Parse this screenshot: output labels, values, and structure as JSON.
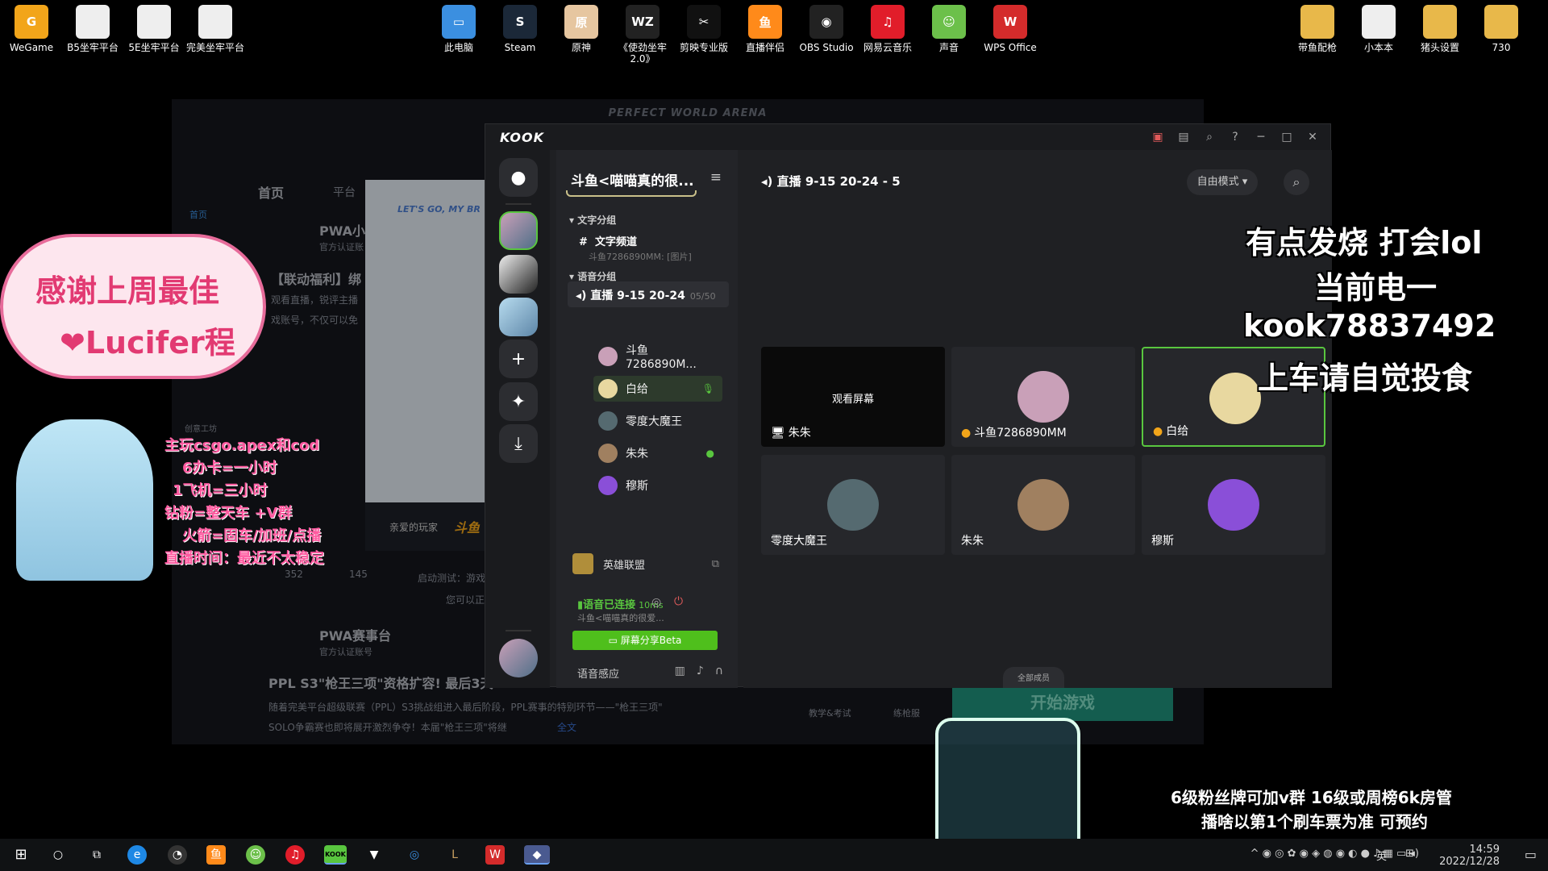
{
  "desktop": {
    "left_icons": [
      {
        "label": "WeGame",
        "glyph": "G",
        "color": "#f2a51a"
      },
      {
        "label": "B5坐牢平台",
        "glyph": "",
        "color": "doc"
      },
      {
        "label": "5E坐牢平台",
        "glyph": "",
        "color": "doc"
      },
      {
        "label": "完美坐牢平台",
        "glyph": "",
        "color": "doc"
      }
    ],
    "center_icons": [
      {
        "label": "此电脑",
        "glyph": "▭",
        "color": "#3b8fe0"
      },
      {
        "label": "Steam",
        "glyph": "S",
        "color": "#1b2838"
      },
      {
        "label": "原神",
        "glyph": "原",
        "color": "#e6c6a0"
      },
      {
        "label": "《使劲坐牢 2.0》",
        "glyph": "WZ",
        "color": "#222"
      },
      {
        "label": "剪映专业版",
        "glyph": "✂",
        "color": "#111"
      },
      {
        "label": "直播伴侣",
        "glyph": "鱼",
        "color": "#ff8a1a"
      },
      {
        "label": "OBS Studio",
        "glyph": "◉",
        "color": "#222"
      },
      {
        "label": "网易云音乐",
        "glyph": "♫",
        "color": "#e11d2a"
      },
      {
        "label": "声音",
        "glyph": "☺",
        "color": "#6cc04a"
      },
      {
        "label": "WPS Office",
        "glyph": "W",
        "color": "#d42b2b"
      }
    ],
    "right_icons": [
      {
        "label": "带鱼配枪",
        "glyph": "",
        "color": "folder"
      },
      {
        "label": "小本本",
        "glyph": "",
        "color": "doc"
      },
      {
        "label": "猪头设置",
        "glyph": "",
        "color": "folder"
      },
      {
        "label": "730",
        "glyph": "",
        "color": "folder"
      }
    ]
  },
  "pwa": {
    "title": "PERFECT WORLD ARENA",
    "nav_home": "首页",
    "nav_platform": "平台",
    "home_icon_label": "首页",
    "create_label": "创意工坊",
    "post1_author": "PWA小",
    "post1_badge": "官方认证账",
    "post1_title": "【联动福利】绑",
    "post1_line1": "观看直播，锐评主播",
    "post1_line2": "戏账号，不仅可以免",
    "card_banner": "LET'S GO, MY BR",
    "card_footer": "亲爱的玩家",
    "card_footer_brand": "斗鱼",
    "test_text": "启动测试：游戏启动",
    "test_sub": "您可以正",
    "post1_comments": "352",
    "post1_likes": "145",
    "post2_author": "PWA赛事台",
    "post2_badge": "官方认证账号",
    "post2_title": "PPL S3\"枪王三项\"资格扩容! 最后3天",
    "post2_line1": "随着完美平台超级联赛（PPL）S3挑战组进入最后阶段，PPL赛事的特别环节——\"枪王三项\"",
    "post2_line2": "SOLO争霸赛也即将展开激烈争夺！本届\"枪王三项\"将继",
    "post2_more": "全文",
    "teach_label": "教学&考试",
    "practice_label": "练枪服",
    "start_game": "开始游戏"
  },
  "kook": {
    "logo": "KOOK",
    "server_name": "斗鱼<喵喵真的很...",
    "text_group": "文字分组",
    "text_channel": "文字频道",
    "text_channel_last": "斗鱼7286890MM: [图片]",
    "voice_group": "语音分组",
    "voice_channel": "直播 9-15 20-24",
    "voice_count": "05/50",
    "members": [
      {
        "name": "斗鱼7286890M...",
        "avatar": "#c9a0b8",
        "end": ""
      },
      {
        "name": "白给",
        "avatar": "#e8d8a0",
        "end": "🎙"
      },
      {
        "name": "零度大魔王",
        "avatar": "#556a70",
        "end": ""
      },
      {
        "name": "朱朱",
        "avatar": "#a08060",
        "end": "●"
      },
      {
        "name": "穆斯",
        "avatar": "#8a4fd8",
        "end": ""
      }
    ],
    "game_name": "英雄联盟",
    "voice_connected": "语音已连接",
    "latency": "10ms",
    "voice_conn_sub": "斗鱼<喵喵真的很爱...",
    "share_label": "屏幕分享Beta",
    "voice_sense": "语音感应",
    "room_title": "直播 9-15 20-24 - 5",
    "mode_label": "自由模式",
    "watch_screen": "观看屏幕",
    "tiles": [
      {
        "name": "朱朱",
        "avatar": "",
        "type": "screen",
        "icon": "🖥"
      },
      {
        "name": "斗鱼7286890MM",
        "avatar": "#c9a0b8",
        "type": "avatar",
        "icon": "●"
      },
      {
        "name": "白给",
        "avatar": "#e8d8a0",
        "type": "avatar",
        "icon": "●"
      },
      {
        "name": "零度大魔王",
        "avatar": "#556a70",
        "type": "avatar",
        "icon": ""
      },
      {
        "name": "朱朱",
        "avatar": "#a08060",
        "type": "avatar",
        "icon": ""
      },
      {
        "name": "穆斯",
        "avatar": "#8a4fd8",
        "type": "avatar",
        "icon": ""
      }
    ],
    "all_members": "全部成员"
  },
  "overlay": {
    "right_lines": [
      "有点发烧  打会lol",
      "当前电一",
      "kook78837492",
      "上车请自觉投食"
    ],
    "bottom_lines": [
      "6级粉丝牌可加v群    16级或周榜6k房管",
      "播啥以第1个刷车票为准 可预约"
    ],
    "thanks_line1": "感谢上周最佳",
    "thanks_line2": "❤Lucifer程",
    "info_lines": [
      "主玩csgo.apex和cod",
      "6办卡=一小时",
      "1飞机=三小时",
      "钻粉=整天车 +V群",
      "火箭=固车/加班/点播",
      "直播时间：最近不太稳定"
    ]
  },
  "taskbar": {
    "time": "14:59",
    "date": "2022/12/28",
    "ime": "英"
  }
}
